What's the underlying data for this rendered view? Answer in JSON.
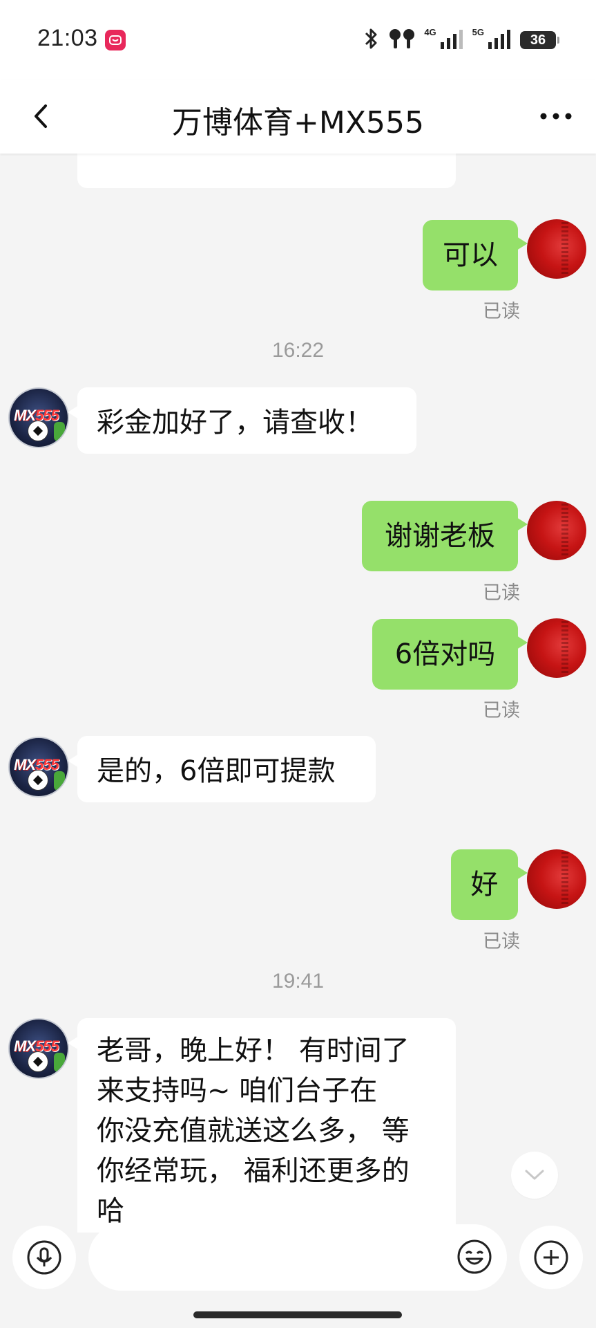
{
  "status_bar": {
    "time": "21:03",
    "network_1": "4G",
    "network_2": "5G",
    "battery": "36",
    "icons": [
      "app-notification-icon",
      "bluetooth-icon",
      "earbuds-icon",
      "signal-icon",
      "signal-icon",
      "battery-icon"
    ]
  },
  "header": {
    "title": "万博体育+MX555",
    "back_icon": "chevron-left-icon",
    "more_icon": "more-horizontal-icon"
  },
  "avatar_other": {
    "text_prefix": "MX",
    "text_number": "555"
  },
  "messages": [
    {
      "type": "out",
      "text": "可以",
      "read": "已读"
    },
    {
      "type": "time",
      "text": "16:22"
    },
    {
      "type": "in",
      "text": "彩金加好了，请查收！"
    },
    {
      "type": "out",
      "text": "谢谢老板",
      "read": "已读"
    },
    {
      "type": "out",
      "text": "6倍对吗",
      "read": "已读"
    },
    {
      "type": "in",
      "text": "是的，6倍即可提款"
    },
    {
      "type": "out",
      "text": "好",
      "read": "已读"
    },
    {
      "type": "time",
      "text": "19:41"
    },
    {
      "type": "in",
      "lines": [
        "老哥，晚上好！  有时间了",
        "来支持吗~     咱们台子在",
        "你没充值就送这么多，  等",
        "你经常玩，  福利还更多的",
        "哈"
      ]
    }
  ],
  "input": {
    "placeholder": "",
    "mic_icon": "microphone-icon",
    "emoji_icon": "emoji-icon",
    "plus_icon": "plus-circle-icon",
    "scroll_icon": "chevron-down-icon"
  },
  "colors": {
    "outgoing_bubble": "#95e06a",
    "incoming_bubble": "#ffffff",
    "background": "#f4f4f4"
  }
}
